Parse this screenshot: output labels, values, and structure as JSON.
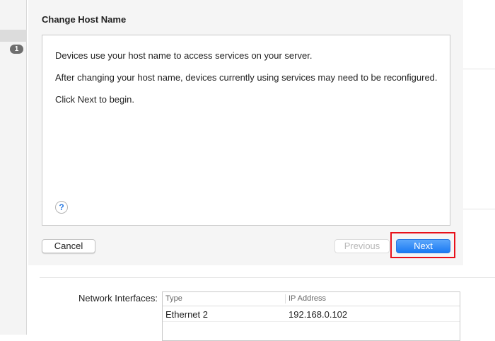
{
  "sidebar": {
    "badge": "1"
  },
  "dialog": {
    "title": "Change Host Name",
    "lines": [
      "Devices use your host name to access services on your server.",
      "After changing your host name, devices currently using services may need to be reconfigured.",
      "Click Next to begin."
    ],
    "help": "?",
    "cancel": "Cancel",
    "previous": "Previous",
    "next": "Next"
  },
  "network": {
    "label": "Network Interfaces:",
    "columns": [
      "Type",
      "IP Address"
    ],
    "rows": [
      [
        "Ethernet 2",
        "192.168.0.102"
      ]
    ]
  },
  "colors": {
    "accent": "#1b7af3",
    "highlight": "#e8101a"
  }
}
